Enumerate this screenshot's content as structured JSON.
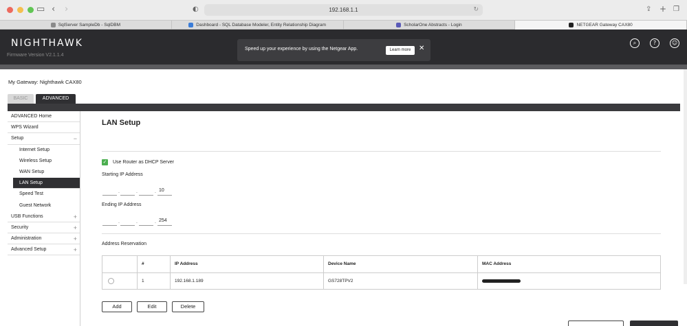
{
  "browser": {
    "url": "192.168.1.1",
    "tabs": [
      {
        "label": "SqlServer SampleDb - SqlDBM",
        "color": "#8a8a8a"
      },
      {
        "label": "Dashboard - SQL Database Modeler, Entity Relationship Diagram",
        "color": "#3b7dd8"
      },
      {
        "label": "ScholarOne Abstracts - Login",
        "color": "#5a5ab8"
      },
      {
        "label": "NETGEAR Gateway CAX80",
        "color": "#222222"
      }
    ]
  },
  "header": {
    "brand": "NIGHTHAWK",
    "firmware": "Firmware Version V2.1.1.4",
    "banner_text": "Speed up your experience by using the Netgear App.",
    "learn_more": "Learn more"
  },
  "gateway_label": "My Gateway: Nighthawk CAX80",
  "mode_tabs": {
    "basic": "BASIC",
    "advanced": "ADVANCED"
  },
  "sidebar": {
    "items": [
      {
        "label": "ADVANCED Home",
        "type": "top"
      },
      {
        "label": "WPS Wizard",
        "type": "top"
      },
      {
        "label": "Setup",
        "type": "section",
        "marker": "−"
      },
      {
        "label": "Internet Setup",
        "type": "sub"
      },
      {
        "label": "Wireless Setup",
        "type": "sub"
      },
      {
        "label": "WAN Setup",
        "type": "sub"
      },
      {
        "label": "LAN Setup",
        "type": "active"
      },
      {
        "label": "Speed Test",
        "type": "sub"
      },
      {
        "label": "Guest Network",
        "type": "sub"
      },
      {
        "label": "USB Functions",
        "type": "section",
        "marker": "+"
      },
      {
        "label": "Security",
        "type": "section",
        "marker": "+"
      },
      {
        "label": "Administration",
        "type": "section",
        "marker": "+"
      },
      {
        "label": "Advanced Setup",
        "type": "section",
        "marker": "+"
      }
    ]
  },
  "main": {
    "title": "LAN Setup",
    "dhcp_label": "Use Router as DHCP Server",
    "start_label": "Starting IP Address",
    "start_last": "10",
    "end_label": "Ending IP Address",
    "end_last": "254",
    "reservation_label": "Address Reservation",
    "table": {
      "headers": [
        "#",
        "IP Address",
        "Device Name",
        "MAC Address"
      ],
      "rows": [
        {
          "num": "1",
          "ip": "192.168.1.189",
          "device": "GS728TPV2"
        }
      ]
    },
    "buttons": {
      "add": "Add",
      "edit": "Edit",
      "delete": "Delete"
    }
  }
}
